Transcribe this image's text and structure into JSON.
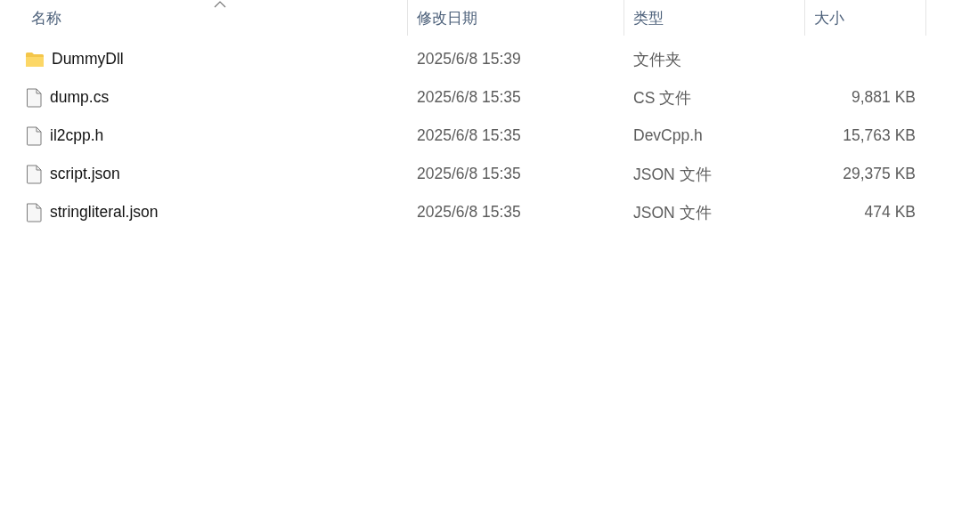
{
  "columns": [
    {
      "label": "名称",
      "sorted": true
    },
    {
      "label": "修改日期",
      "sorted": false
    },
    {
      "label": "类型",
      "sorted": false
    },
    {
      "label": "大小",
      "sorted": false
    }
  ],
  "rows": [
    {
      "kind": "folder",
      "name": "DummyDll",
      "modified": "2025/6/8 15:39",
      "type": "文件夹"
    },
    {
      "kind": "file",
      "name": "dump.cs",
      "modified": "2025/6/8 15:35",
      "type": "CS 文件",
      "size": "9,881 KB"
    },
    {
      "kind": "file",
      "name": "il2cpp.h",
      "modified": "2025/6/8 15:35",
      "type": "DevCpp.h",
      "size": "15,763 KB"
    },
    {
      "kind": "file",
      "name": "script.json",
      "modified": "2025/6/8 15:35",
      "type": "JSON 文件",
      "size": "29,375 KB"
    },
    {
      "kind": "file",
      "name": "stringliteral.json",
      "modified": "2025/6/8 15:35",
      "type": "JSON 文件",
      "size": "474 KB"
    }
  ]
}
